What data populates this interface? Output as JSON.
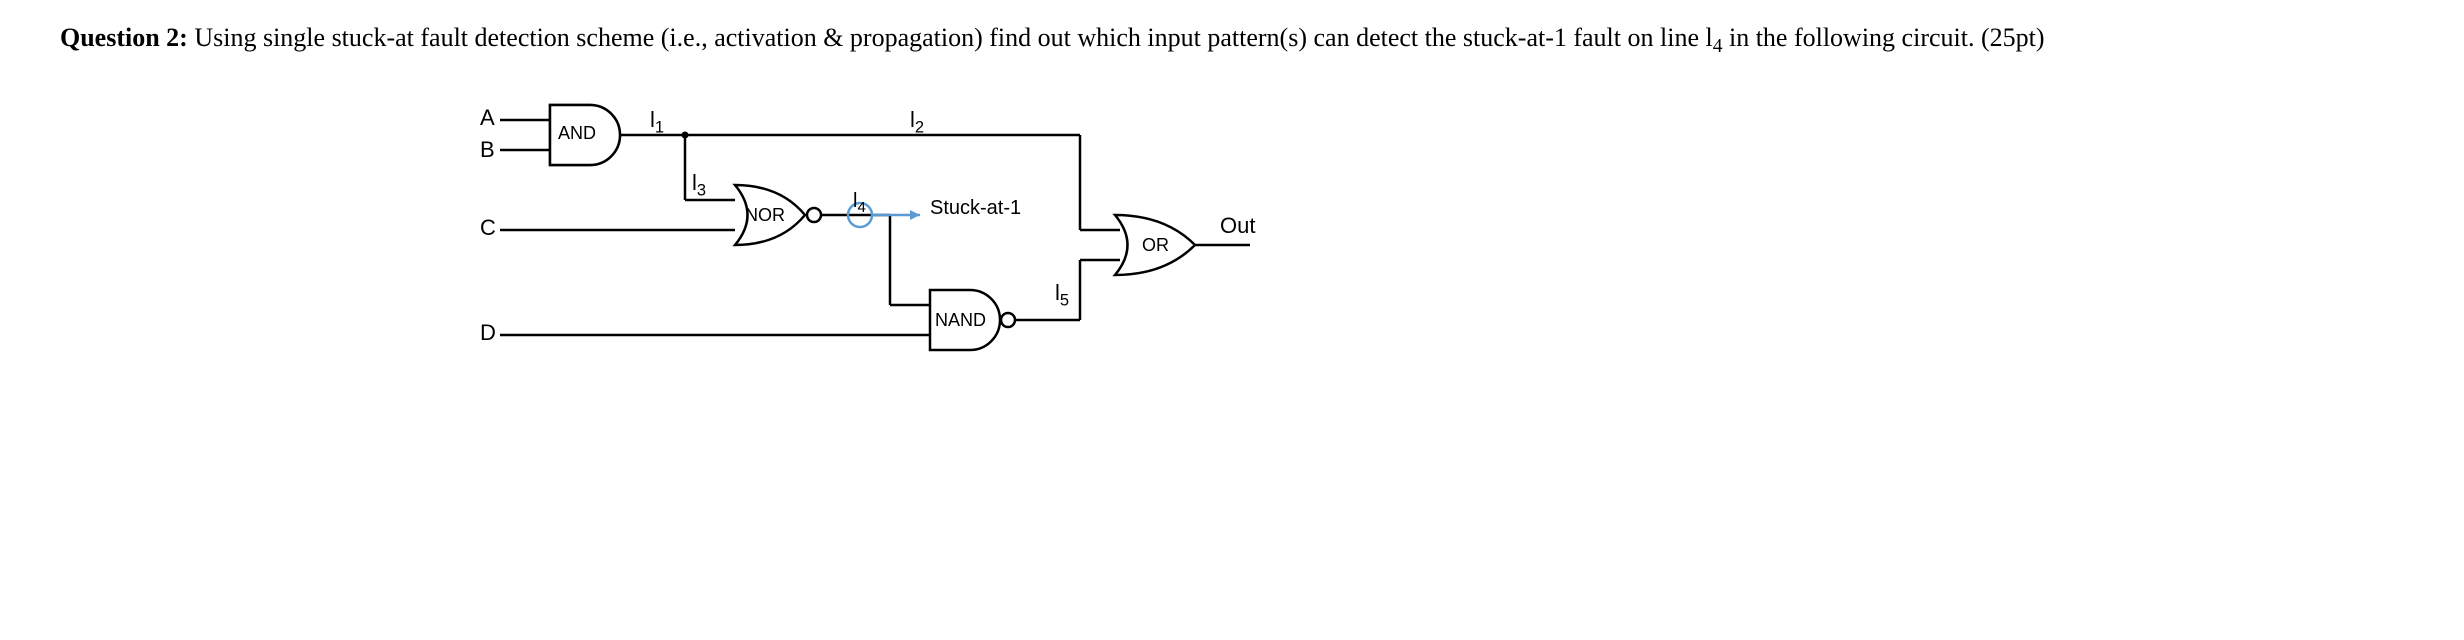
{
  "question": {
    "label": "Question 2:",
    "text_part1": " Using single stuck-at fault detection scheme (i.e., activation & propagation) find out which input pattern(s) can detect the stuck-at-1 fault on line l",
    "subscript1": "4",
    "text_part2": " in the following circuit. (25pt)"
  },
  "circuit": {
    "inputs": {
      "A": "A",
      "B": "B",
      "C": "C",
      "D": "D"
    },
    "gates": {
      "and": "AND",
      "nor": "NOR",
      "nand": "NAND",
      "or": "OR"
    },
    "lines": {
      "l1": "l",
      "l1_sub": "1",
      "l2": "l",
      "l2_sub": "2",
      "l3": "l",
      "l3_sub": "3",
      "l4": "l",
      "l4_sub": "4",
      "l5": "l",
      "l5_sub": "5"
    },
    "fault_label": "Stuck-at-1",
    "output_label": "Out"
  }
}
